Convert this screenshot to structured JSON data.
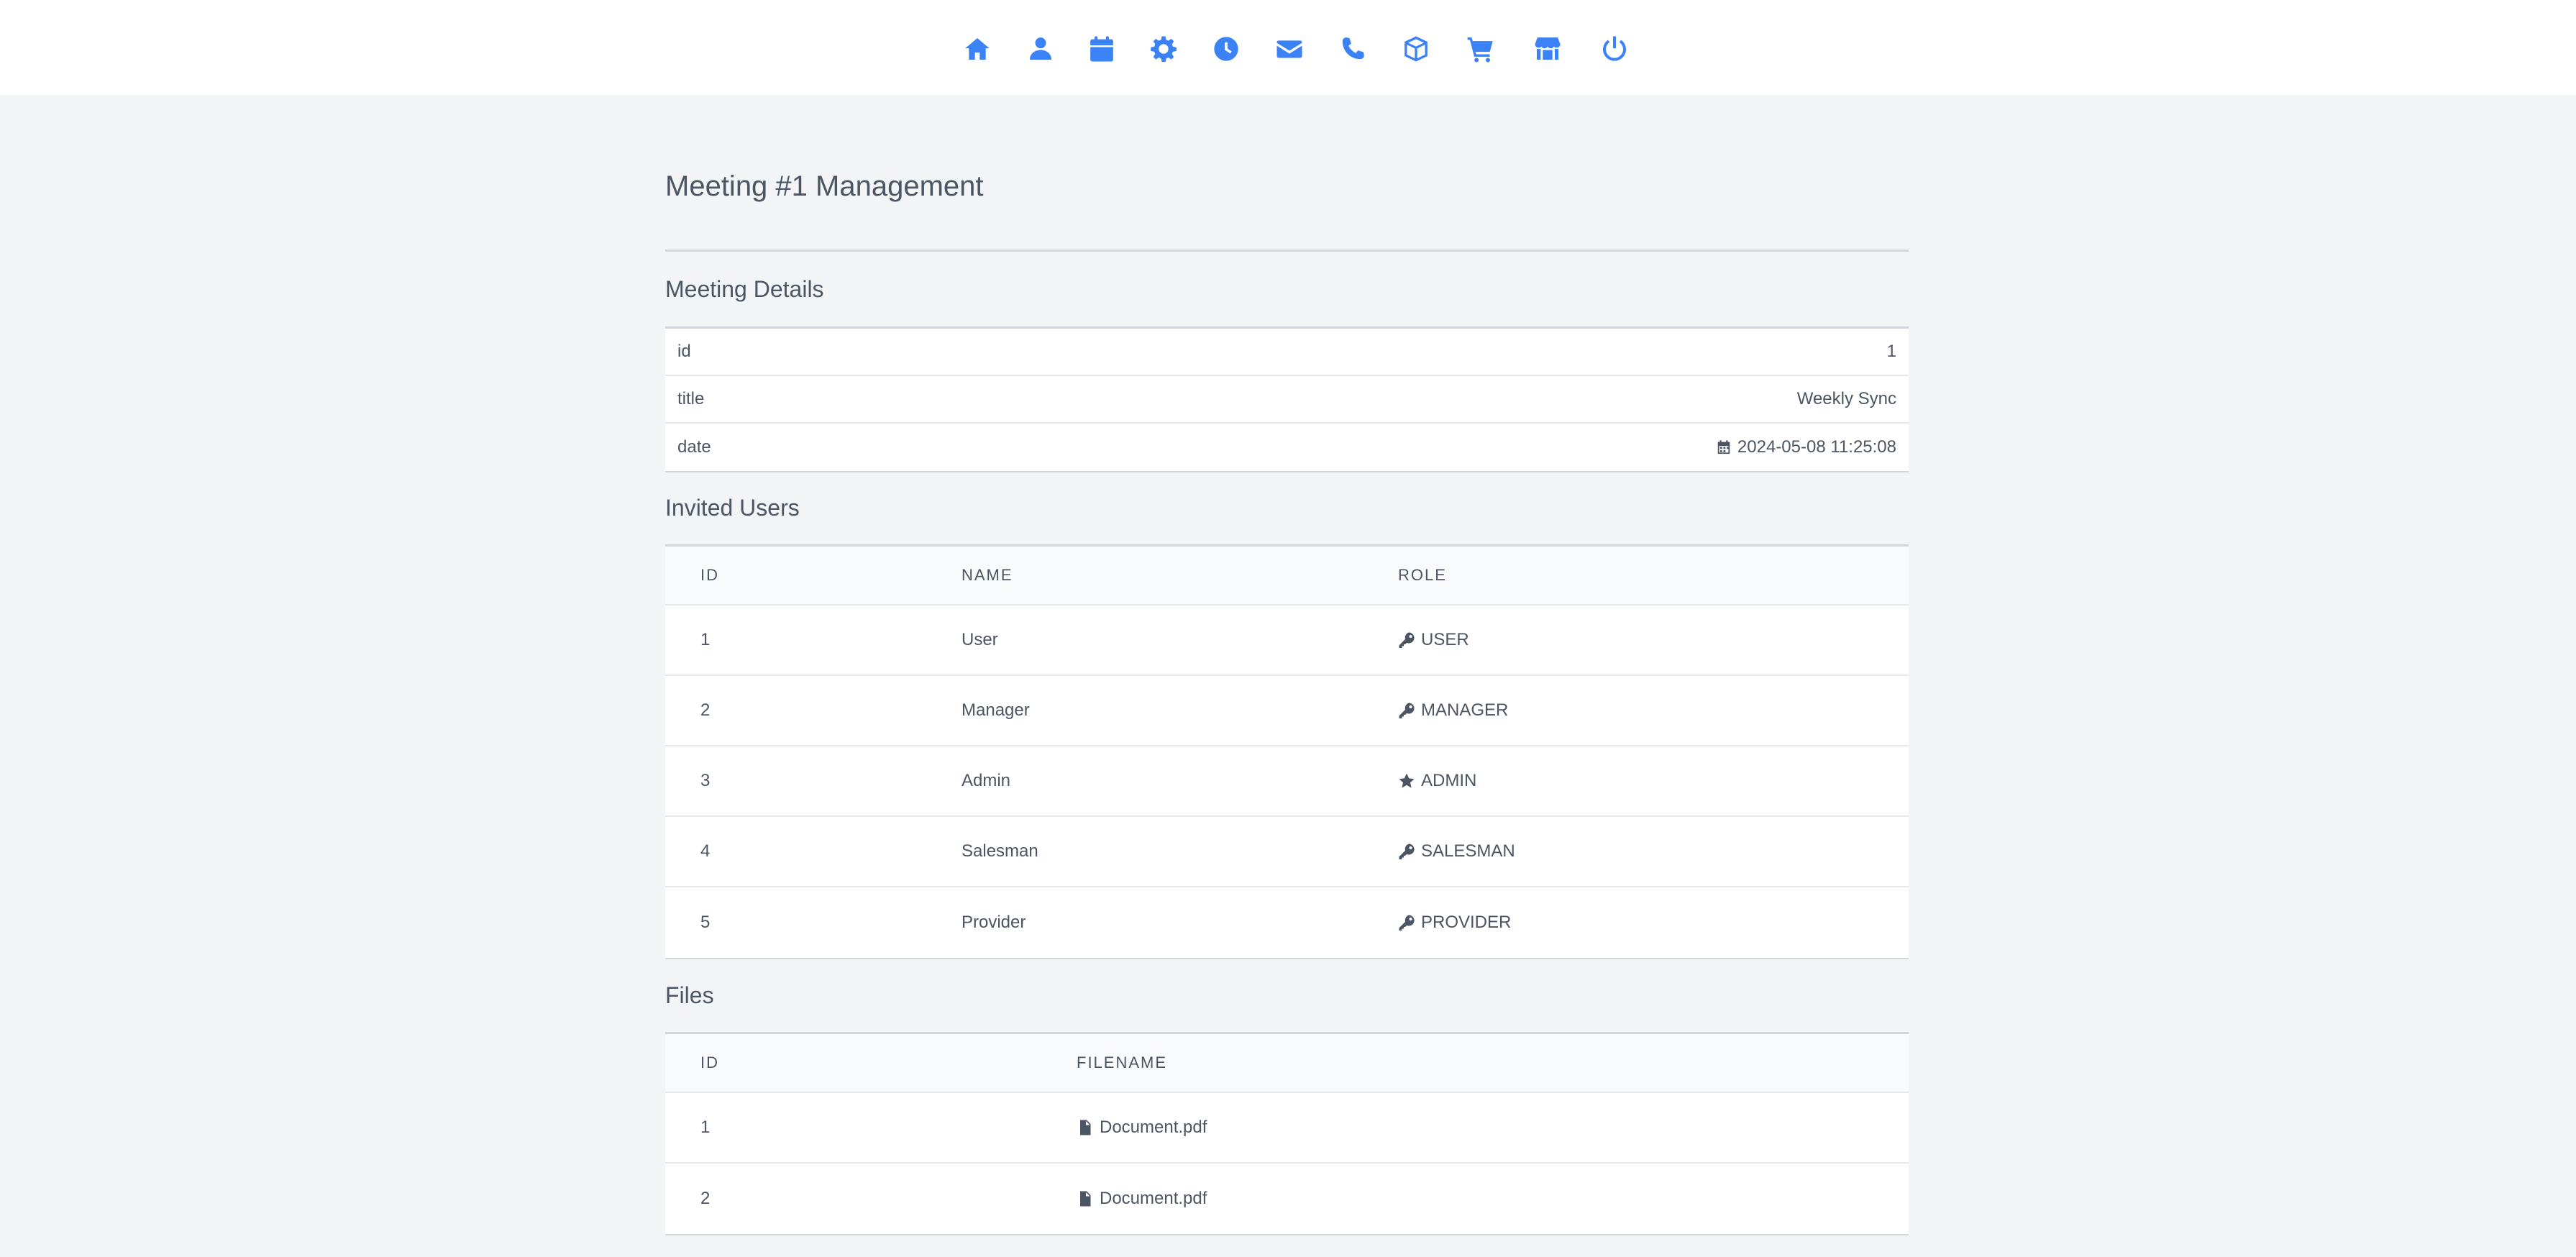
{
  "nav": {
    "icons": [
      "home-icon",
      "user-icon",
      "calendar-icon",
      "settings-gear-icon",
      "clock-icon",
      "mail-icon",
      "phone-icon",
      "box-icon",
      "cart-icon",
      "store-icon",
      "power-icon"
    ],
    "accent_color": "#3b82f6"
  },
  "page": {
    "title": "Meeting #1 Management"
  },
  "details": {
    "section_title": "Meeting Details",
    "rows": [
      {
        "label": "id",
        "value": "1"
      },
      {
        "label": "title",
        "value": "Weekly Sync"
      },
      {
        "label": "date",
        "value": "2024-05-08 11:25:08",
        "icon": "calendar-icon"
      }
    ]
  },
  "invited": {
    "section_title": "Invited Users",
    "headers": [
      "ID",
      "NAME",
      "ROLE"
    ],
    "rows": [
      {
        "id": "1",
        "name": "User",
        "role": "USER",
        "role_icon": "key-icon"
      },
      {
        "id": "2",
        "name": "Manager",
        "role": "MANAGER",
        "role_icon": "key-icon"
      },
      {
        "id": "3",
        "name": "Admin",
        "role": "ADMIN",
        "role_icon": "star-icon"
      },
      {
        "id": "4",
        "name": "Salesman",
        "role": "SALESMAN",
        "role_icon": "key-icon"
      },
      {
        "id": "5",
        "name": "Provider",
        "role": "PROVIDER",
        "role_icon": "key-icon"
      }
    ]
  },
  "files": {
    "section_title": "Files",
    "headers": [
      "ID",
      "FILENAME"
    ],
    "rows": [
      {
        "id": "1",
        "filename": "Document.pdf",
        "icon": "file-icon"
      },
      {
        "id": "2",
        "filename": "Document.pdf",
        "icon": "file-icon"
      }
    ]
  }
}
